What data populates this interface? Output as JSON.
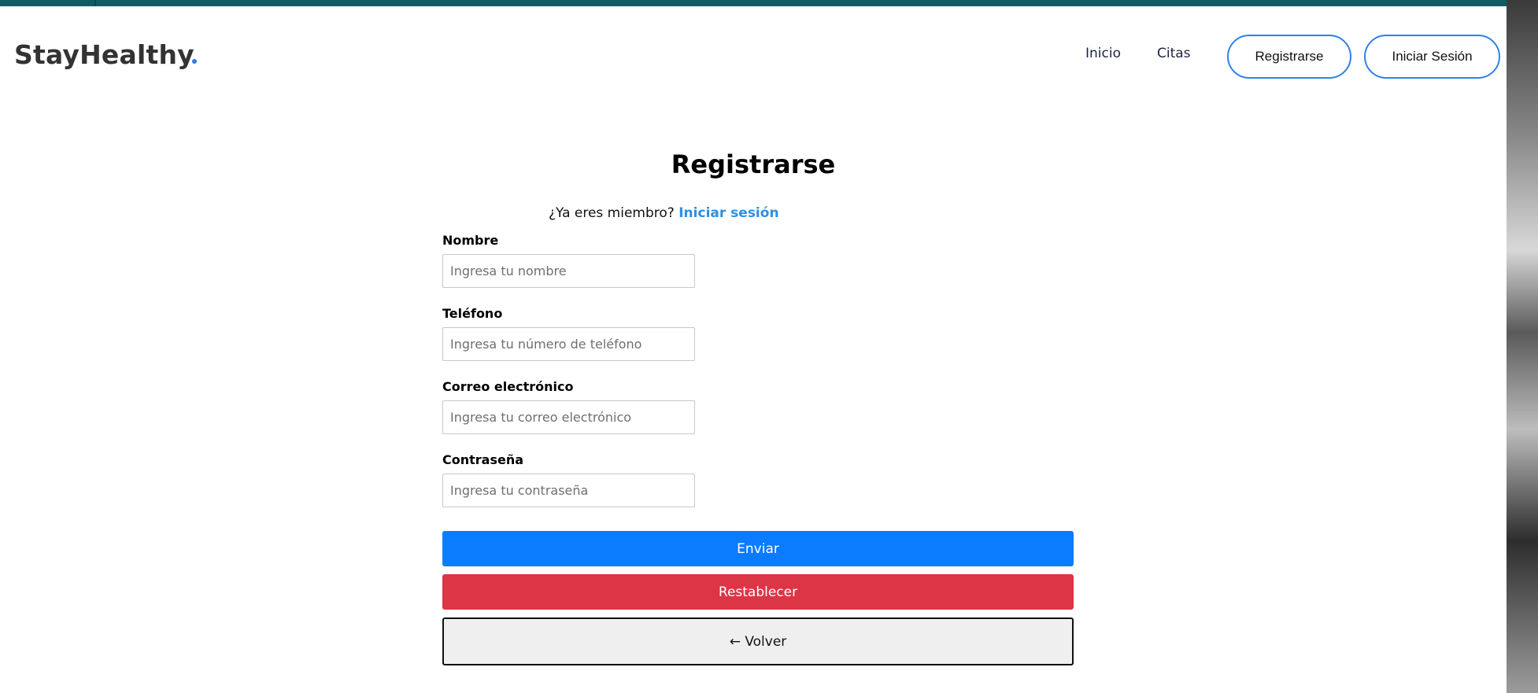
{
  "header": {
    "brand": "StayHealthy",
    "nav": {
      "home": "Inicio",
      "appointments": "Citas",
      "register": "Registrarse",
      "login": "Iniciar Sesión"
    },
    "accent_color": "#2f80ed"
  },
  "form": {
    "title": "Registrarse",
    "member_prompt": "¿Ya eres miembro?",
    "member_login_link": "Iniciar sesión",
    "fields": {
      "name": {
        "label": "Nombre",
        "placeholder": "Ingresa tu nombre",
        "value": ""
      },
      "phone": {
        "label": "Teléfono",
        "placeholder": "Ingresa tu número de teléfono",
        "value": ""
      },
      "email": {
        "label": "Correo electrónico",
        "placeholder": "Ingresa tu correo electrónico",
        "value": ""
      },
      "password": {
        "label": "Contraseña",
        "placeholder": "Ingresa tu contraseña",
        "value": ""
      }
    },
    "buttons": {
      "submit": "Enviar",
      "reset": "Restablecer",
      "back": "← Volver"
    },
    "colors": {
      "submit": "#0b7bff",
      "reset": "#dc3545",
      "back": "#efefef"
    }
  }
}
